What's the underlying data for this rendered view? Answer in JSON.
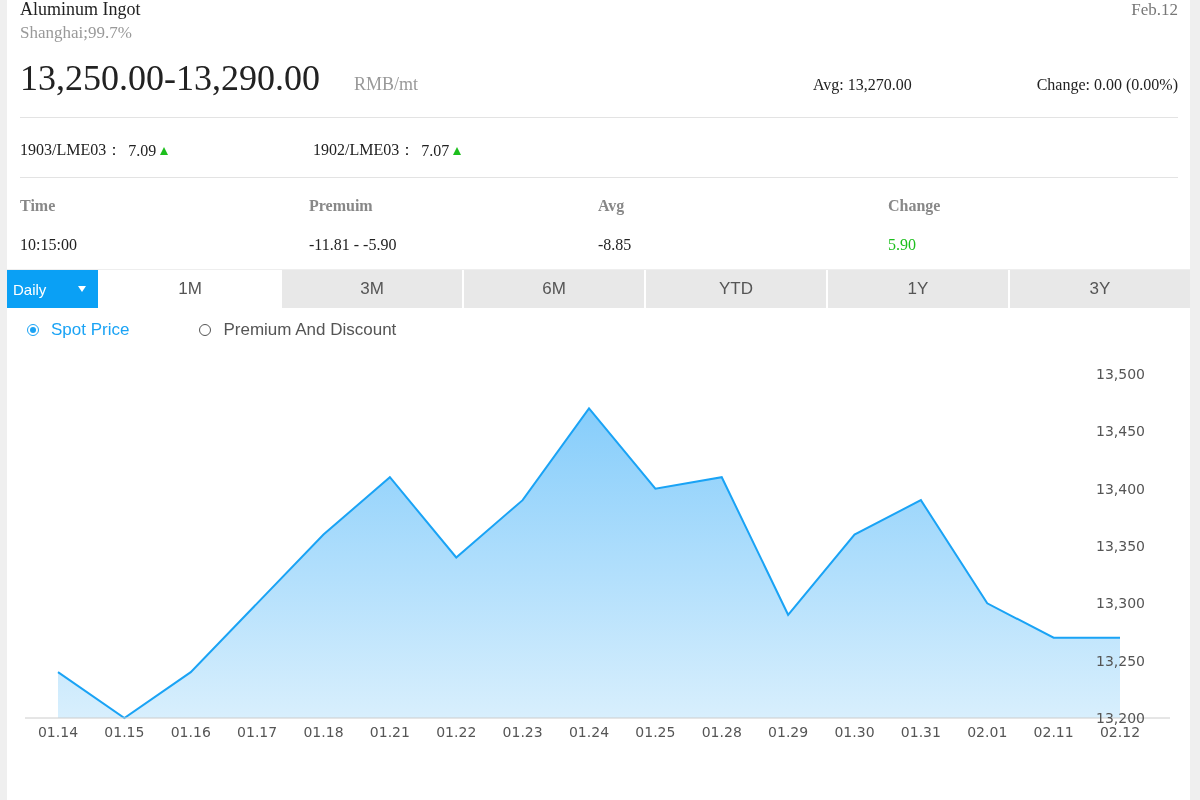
{
  "header": {
    "title": "Aluminum Ingot",
    "date": "Feb.12",
    "subtitle": "Shanghai;99.7%",
    "price": "13,250.00-13,290.00",
    "unit": "RMB/mt",
    "avg": "Avg: 13,270.00",
    "change": "Change: 0.00 (0.00%)"
  },
  "ratios": [
    {
      "label": "1903/LME03：",
      "value": "7.09",
      "rising": true
    },
    {
      "label": "1902/LME03：",
      "value": "7.07",
      "rising": true
    }
  ],
  "premium_table": {
    "columns": [
      "Time",
      "Premuim",
      "Avg",
      "Change"
    ],
    "rows": [
      {
        "cells": [
          "10:15:00",
          "-11.81 - -5.90",
          "-8.85",
          "5.90"
        ],
        "rising": true
      }
    ]
  },
  "period_select": {
    "value": "Daily"
  },
  "tabs": [
    {
      "label": "1M",
      "selected": true
    },
    {
      "label": "3M",
      "selected": false
    },
    {
      "label": "6M",
      "selected": false
    },
    {
      "label": "YTD",
      "selected": false
    },
    {
      "label": "1Y",
      "selected": false
    },
    {
      "label": "3Y",
      "selected": false
    }
  ],
  "chart_mode": [
    {
      "label": "Spot Price",
      "selected": true
    },
    {
      "label": "Premium And Discount",
      "selected": false
    }
  ],
  "chart_data": {
    "type": "area",
    "categories": [
      "01.14",
      "01.15",
      "01.16",
      "01.17",
      "01.18",
      "01.21",
      "01.22",
      "01.23",
      "01.24",
      "01.25",
      "01.28",
      "01.29",
      "01.30",
      "01.31",
      "02.01",
      "02.11",
      "02.12"
    ],
    "series": [
      {
        "color": "#1aa3f5",
        "values": [
          13240,
          13200,
          13240,
          13300,
          13360,
          13410,
          13340,
          13390,
          13470,
          13400,
          13410,
          13290,
          13360,
          13390,
          13300,
          13270,
          13270
        ]
      }
    ],
    "ylim": [
      13200,
      13500
    ],
    "yticks": [
      {
        "value": 13200,
        "label": "13,200"
      },
      {
        "value": 13250,
        "label": "13,250"
      },
      {
        "value": 13300,
        "label": "13,300"
      },
      {
        "value": 13350,
        "label": "13,350"
      },
      {
        "value": 13400,
        "label": "13,400"
      },
      {
        "value": 13450,
        "label": "13,450"
      },
      {
        "value": 13500,
        "label": "13,500"
      }
    ]
  }
}
